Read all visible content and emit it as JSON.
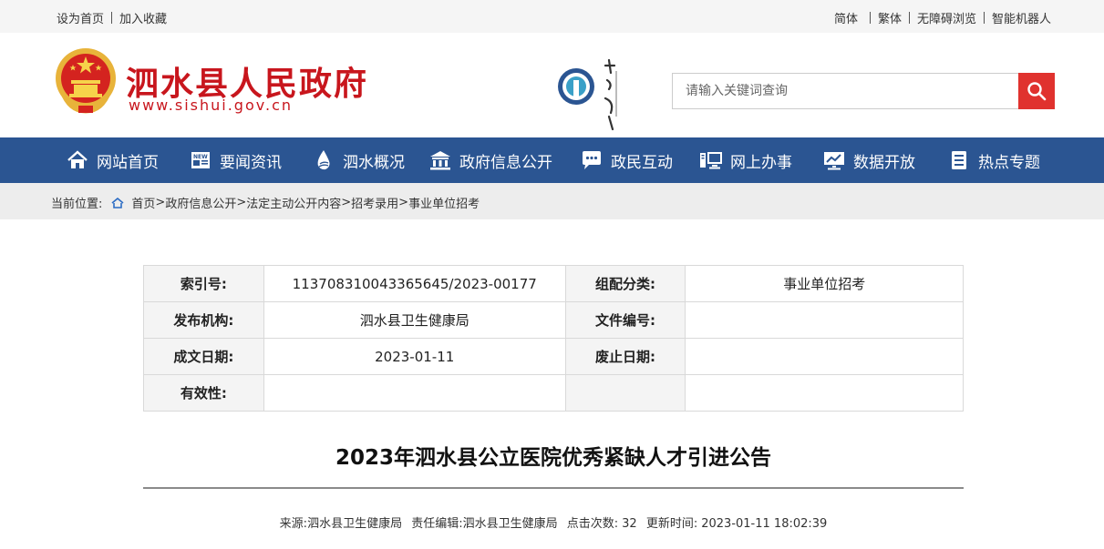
{
  "topbar": {
    "set_home": "设为首页",
    "add_favorite": "加入收藏",
    "simplified": "简体",
    "traditional": "繁体",
    "accessible": "无障碍浏览",
    "robot": "智能机器人"
  },
  "header": {
    "title": "泗水县人民政府",
    "url": "www.sishui.gov.cn",
    "search_placeholder": "请输入关键词查询"
  },
  "nav": {
    "items": [
      {
        "label": "网站首页",
        "icon": "home-icon"
      },
      {
        "label": "要闻资讯",
        "icon": "news-icon"
      },
      {
        "label": "泗水概况",
        "icon": "water-drop-icon"
      },
      {
        "label": "政府信息公开",
        "icon": "government-building-icon"
      },
      {
        "label": "政民互动",
        "icon": "chat-icon"
      },
      {
        "label": "网上办事",
        "icon": "monitor-icon"
      },
      {
        "label": "数据开放",
        "icon": "chart-screen-icon"
      },
      {
        "label": "热点专题",
        "icon": "document-list-icon"
      }
    ]
  },
  "breadcrumb": {
    "label": "当前位置:",
    "items": [
      "首页",
      "政府信息公开",
      "法定主动公开内容",
      "招考录用",
      "事业单位招考"
    ]
  },
  "meta": {
    "index_label": "索引号:",
    "index_value": "113708310043365645/2023-00177",
    "category_label": "组配分类:",
    "category_value": "事业单位招考",
    "publisher_label": "发布机构:",
    "publisher_value": "泗水县卫生健康局",
    "doc_no_label": "文件编号:",
    "doc_no_value": "",
    "date_label": "成文日期:",
    "date_value": "2023-01-11",
    "abolish_label": "废止日期:",
    "abolish_value": "",
    "validity_label": "有效性:",
    "validity_value": ""
  },
  "article": {
    "title": "2023年泗水县公立医院优秀紧缺人才引进公告",
    "source_label": "来源:",
    "source": "泗水县卫生健康局",
    "editor_label": "责任编辑:",
    "editor": "泗水县卫生健康局",
    "clicks_label": "点击次数:",
    "clicks": "32",
    "updated_label": "更新时间:",
    "updated": "2023-01-11 18:02:39"
  },
  "colors": {
    "brand_red": "#c8161d",
    "nav_blue": "#2b5592",
    "search_red": "#e0322e"
  }
}
